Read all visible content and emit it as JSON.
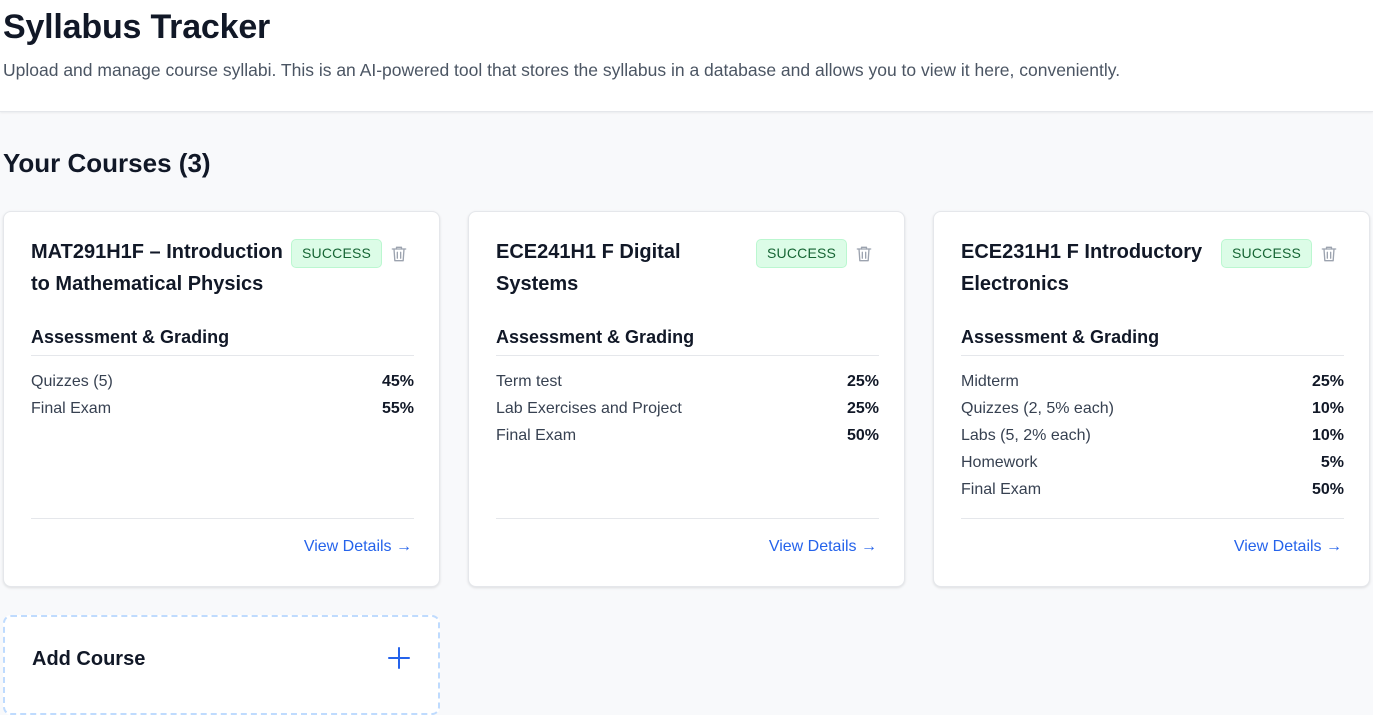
{
  "header": {
    "title": "Syllabus Tracker",
    "subtitle": "Upload and manage course syllabi. This is an AI-powered tool that stores the syllabus in a database and allows you to view it here, conveniently."
  },
  "courses_section": {
    "title": "Your Courses (3)"
  },
  "courses": [
    {
      "title": "MAT291H1F – Introduction to Mathematical Physics",
      "status": "SUCCESS",
      "section_label": "Assessment & Grading",
      "grades": [
        {
          "name": "Quizzes (5)",
          "weight": "45%"
        },
        {
          "name": "Final Exam",
          "weight": "55%"
        }
      ],
      "link": "View Details →"
    },
    {
      "title": "ECE241H1 F Digital Systems",
      "status": "SUCCESS",
      "section_label": "Assessment & Grading",
      "grades": [
        {
          "name": "Term test",
          "weight": "25%"
        },
        {
          "name": "Lab Exercises and Project",
          "weight": "25%"
        },
        {
          "name": "Final Exam",
          "weight": "50%"
        }
      ],
      "link": "View Details →"
    },
    {
      "title": "ECE231H1 F Introductory Electronics",
      "status": "SUCCESS",
      "section_label": "Assessment & Grading",
      "grades": [
        {
          "name": "Midterm",
          "weight": "25%"
        },
        {
          "name": "Quizzes (2, 5% each)",
          "weight": "10%"
        },
        {
          "name": "Labs (5, 2% each)",
          "weight": "10%"
        },
        {
          "name": "Homework",
          "weight": "5%"
        },
        {
          "name": "Final Exam",
          "weight": "50%"
        }
      ],
      "link": "View Details →"
    }
  ],
  "add_course": {
    "label": "Add Course",
    "icon": "plus-icon"
  },
  "icons": {
    "delete": "trash-icon",
    "add": "plus-icon"
  },
  "colors": {
    "accent": "#2563eb",
    "success_bg": "#dcfce7",
    "success_text": "#166534",
    "page_bg": "#f8f9fb"
  }
}
